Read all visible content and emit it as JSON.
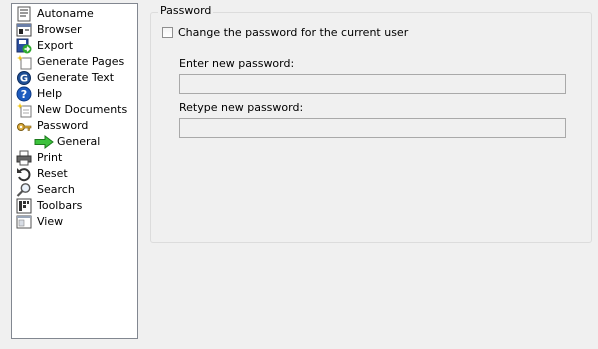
{
  "tree": {
    "items": [
      {
        "label": "Autoname",
        "icon": "autoname-icon"
      },
      {
        "label": "Browser",
        "icon": "browser-icon"
      },
      {
        "label": "Export",
        "icon": "export-icon"
      },
      {
        "label": "Generate Pages",
        "icon": "generate-pages-icon"
      },
      {
        "label": "Generate Text",
        "icon": "generate-text-icon"
      },
      {
        "label": "Help",
        "icon": "help-icon"
      },
      {
        "label": "New Documents",
        "icon": "new-documents-icon"
      },
      {
        "label": "Password",
        "icon": "key-icon"
      },
      {
        "label": "General",
        "icon": "green-arrow-icon",
        "child": true
      },
      {
        "label": "Print",
        "icon": "printer-icon"
      },
      {
        "label": "Reset",
        "icon": "reset-icon"
      },
      {
        "label": "Search",
        "icon": "search-icon"
      },
      {
        "label": "Toolbars",
        "icon": "toolbars-icon"
      },
      {
        "label": "View",
        "icon": "view-icon"
      }
    ]
  },
  "password_group": {
    "title": "Password",
    "change_checkbox_label": "Change the password for the current user",
    "change_checked": false,
    "new_password_label": "Enter new password:",
    "new_password_value": "",
    "retype_label": "Retype new password:",
    "retype_value": ""
  },
  "colors": {
    "window_bg": "#f0f0f0",
    "tree_border": "#828790",
    "disabled_field_bg": "#f0f0f0"
  }
}
